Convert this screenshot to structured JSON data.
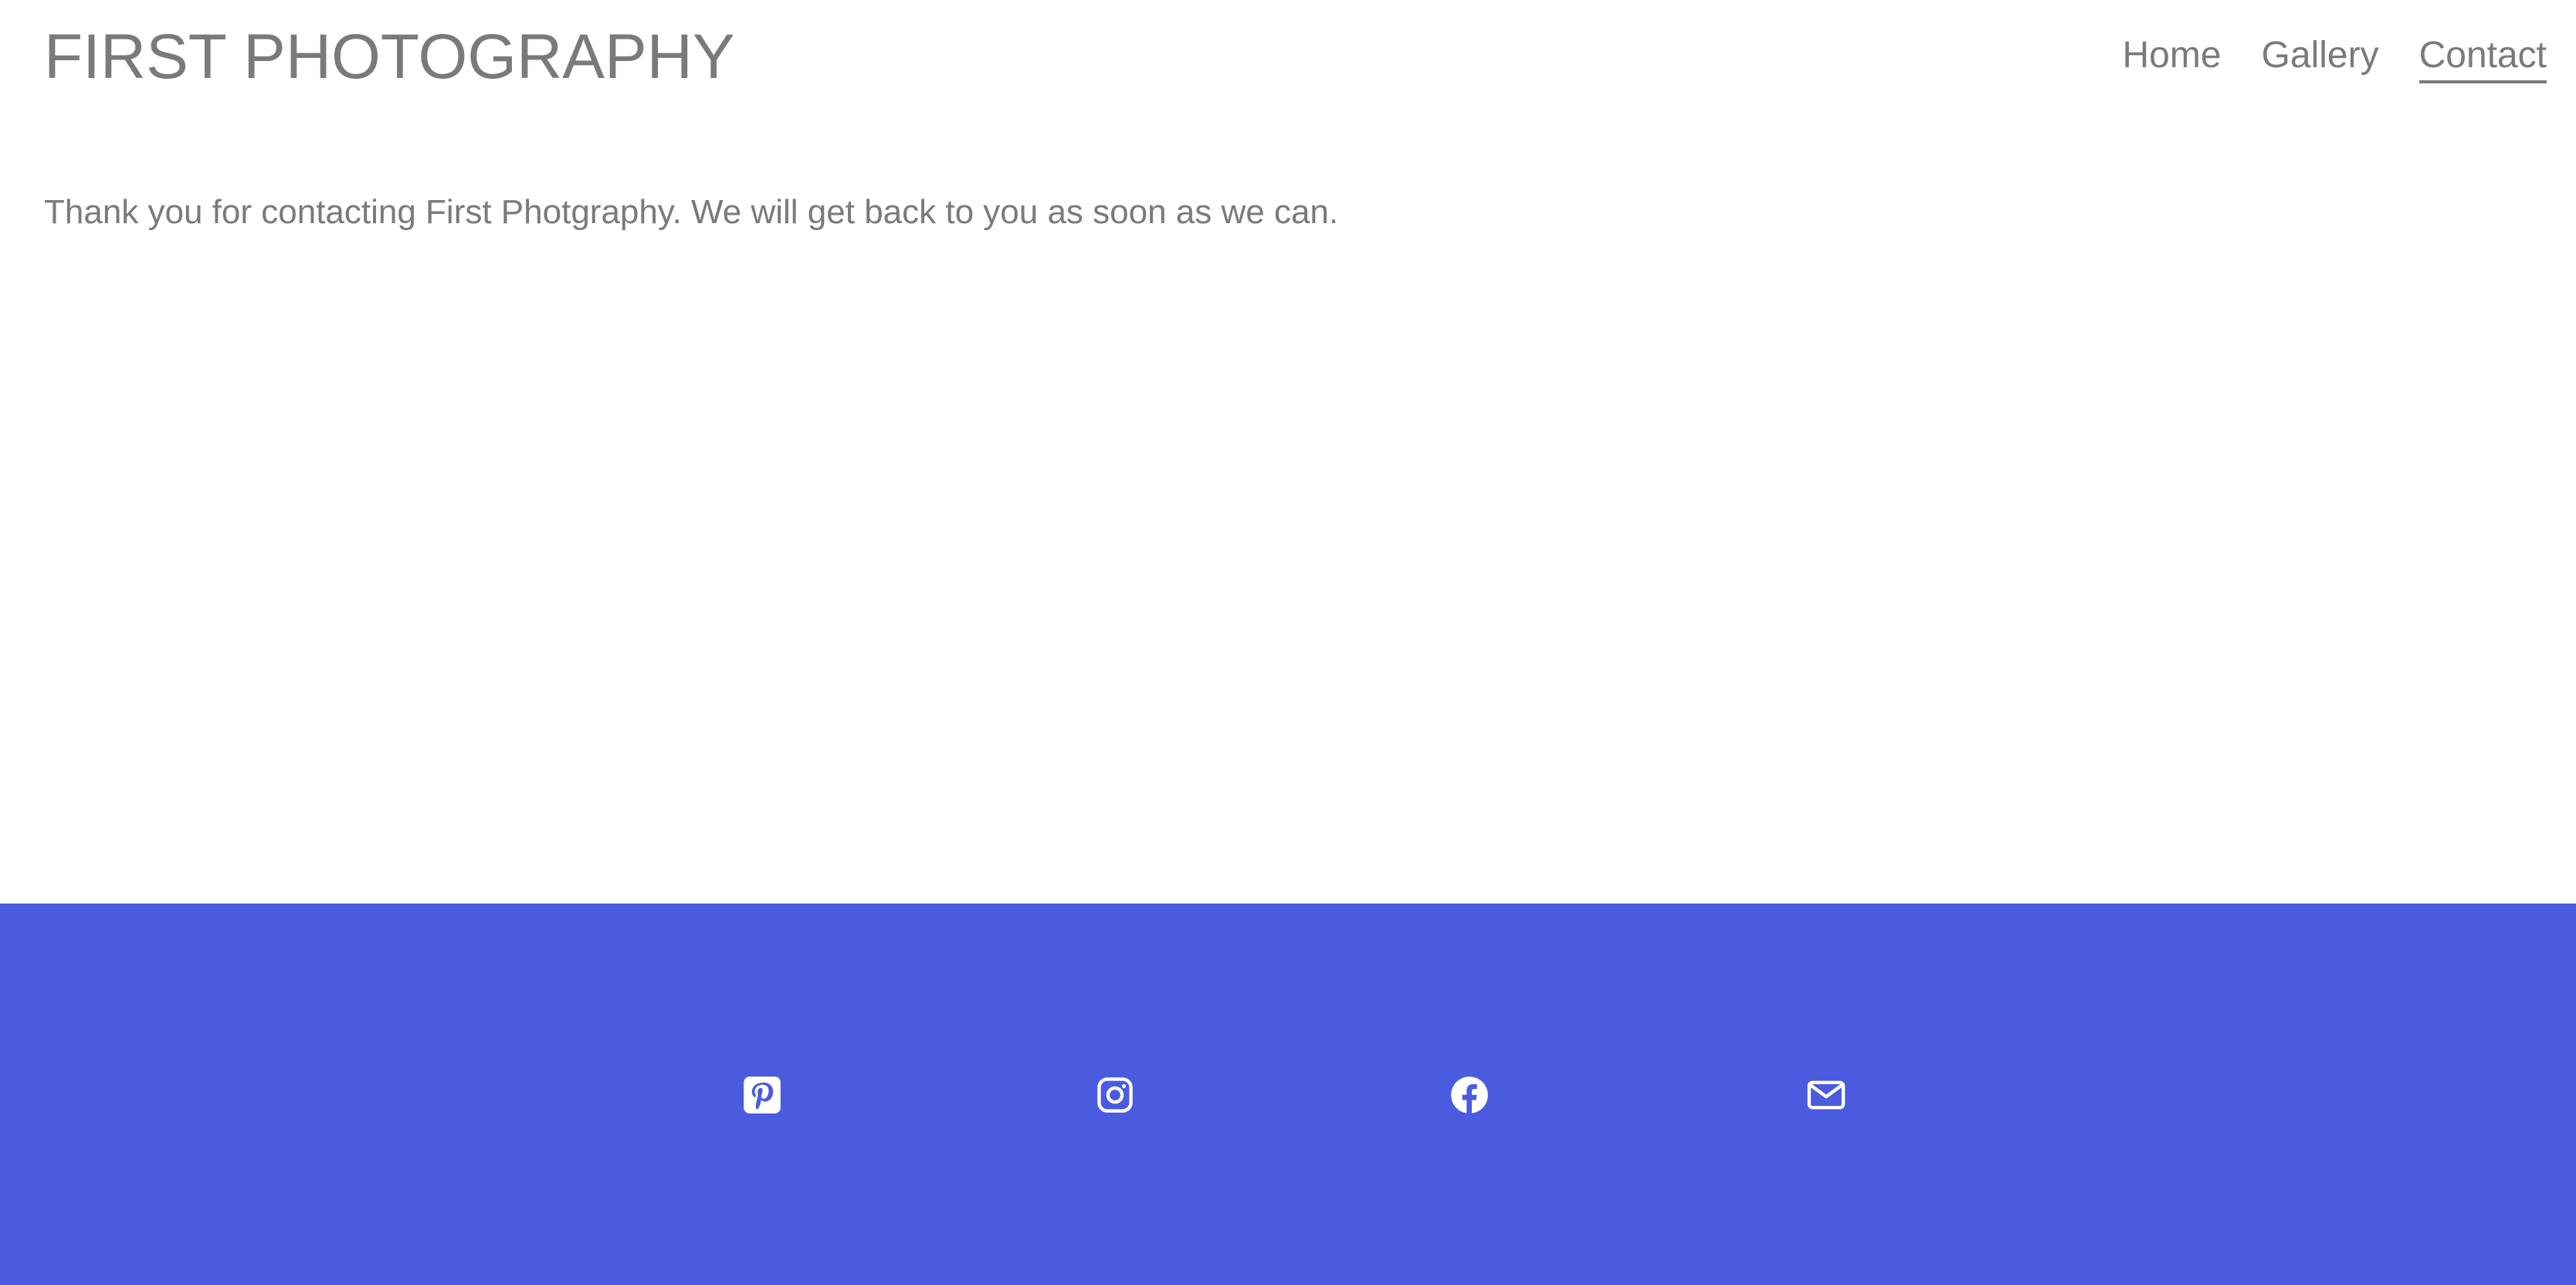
{
  "header": {
    "brand": "FIRST PHOTOGRAPHY",
    "nav": [
      {
        "label": "Home"
      },
      {
        "label": "Gallery"
      },
      {
        "label": "Contact"
      }
    ],
    "active_nav": "Contact"
  },
  "main": {
    "message": "Thank you for contacting First Photgraphy. We will get back to you as soon as we can."
  },
  "footer": {
    "background_color": "#4a5bdf",
    "icons": [
      "pinterest-icon",
      "instagram-icon",
      "facebook-icon",
      "email-icon"
    ]
  },
  "colors": {
    "text_gray": "#7a7a7a",
    "footer_blue": "#4a5bdf"
  }
}
